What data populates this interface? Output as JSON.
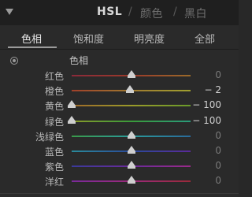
{
  "header": {
    "modes": [
      "HSL",
      "颜色",
      "黑白"
    ],
    "separator": "/"
  },
  "tabs": [
    "色相",
    "饱和度",
    "明亮度",
    "全部"
  ],
  "section": {
    "title": "色相"
  },
  "sliders": [
    {
      "label": "红色",
      "value": "0",
      "level": 0.5,
      "gradient": [
        "#8a2a3a",
        "#9a3a2a",
        "#9a6a2a"
      ]
    },
    {
      "label": "橙色",
      "value": "− 2",
      "level": 0.49,
      "gradient": [
        "#a0402a",
        "#a07a30",
        "#a0a030"
      ]
    },
    {
      "label": "黄色",
      "value": "− 100",
      "level": 0.0,
      "gradient": [
        "#a06a2a",
        "#9a9a2a",
        "#6a9a2a"
      ]
    },
    {
      "label": "绿色",
      "value": "− 100",
      "level": 0.0,
      "gradient": [
        "#8a9a2a",
        "#3a9a3a",
        "#2a9a7a"
      ]
    },
    {
      "label": "浅绿色",
      "value": "0",
      "level": 0.5,
      "gradient": [
        "#3a9a4a",
        "#2a9a9a",
        "#2a6a9a"
      ]
    },
    {
      "label": "蓝色",
      "value": "0",
      "level": 0.5,
      "gradient": [
        "#2a8a9a",
        "#2a4a9a",
        "#5a2a9a"
      ]
    },
    {
      "label": "紫色",
      "value": "0",
      "level": 0.5,
      "gradient": [
        "#3a3a9a",
        "#6a2a9a",
        "#9a2a8a"
      ]
    },
    {
      "label": "洋红",
      "value": "0",
      "level": 0.5,
      "gradient": [
        "#7a2a9a",
        "#9a2a7a",
        "#9a2a3a"
      ]
    }
  ]
}
